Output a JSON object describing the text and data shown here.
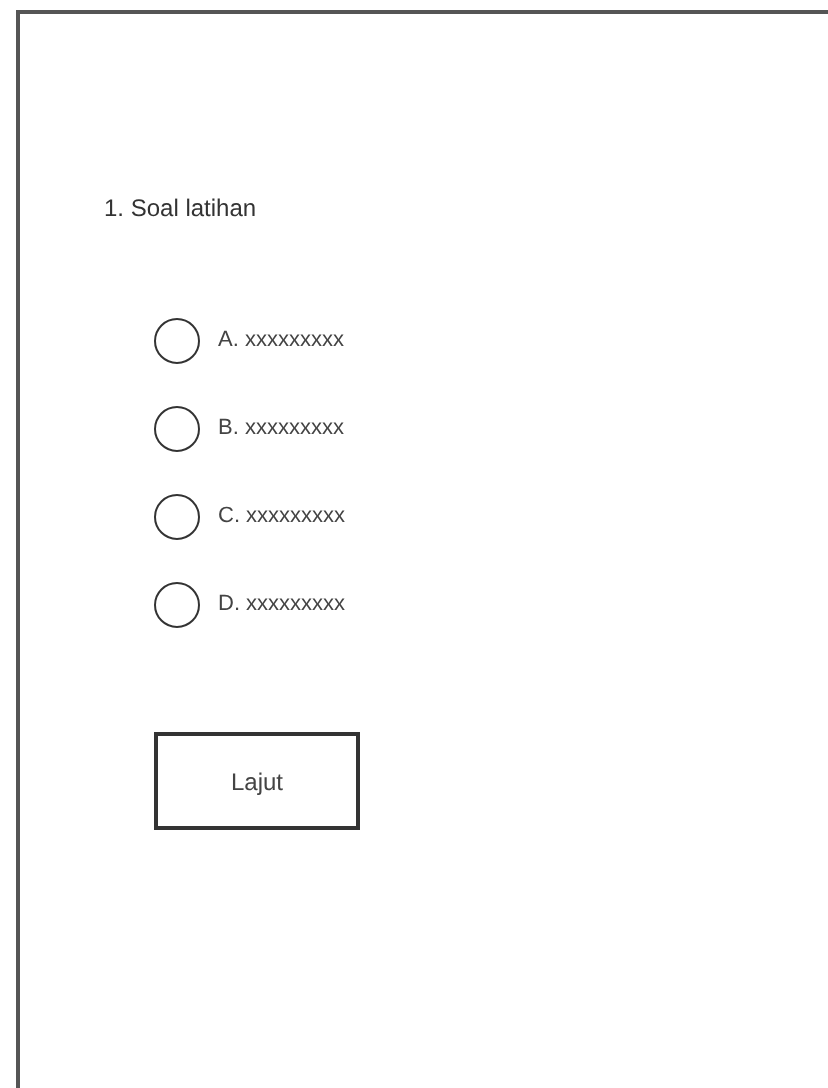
{
  "question": "1. Soal latihan",
  "options": [
    {
      "label": "A. xxxxxxxxx",
      "selected": false
    },
    {
      "label": "B. xxxxxxxxx",
      "selected": false
    },
    {
      "label": "C. xxxxxxxxx",
      "selected": false
    },
    {
      "label": "D. xxxxxxxxx",
      "selected": false
    }
  ],
  "button": "Lajut"
}
